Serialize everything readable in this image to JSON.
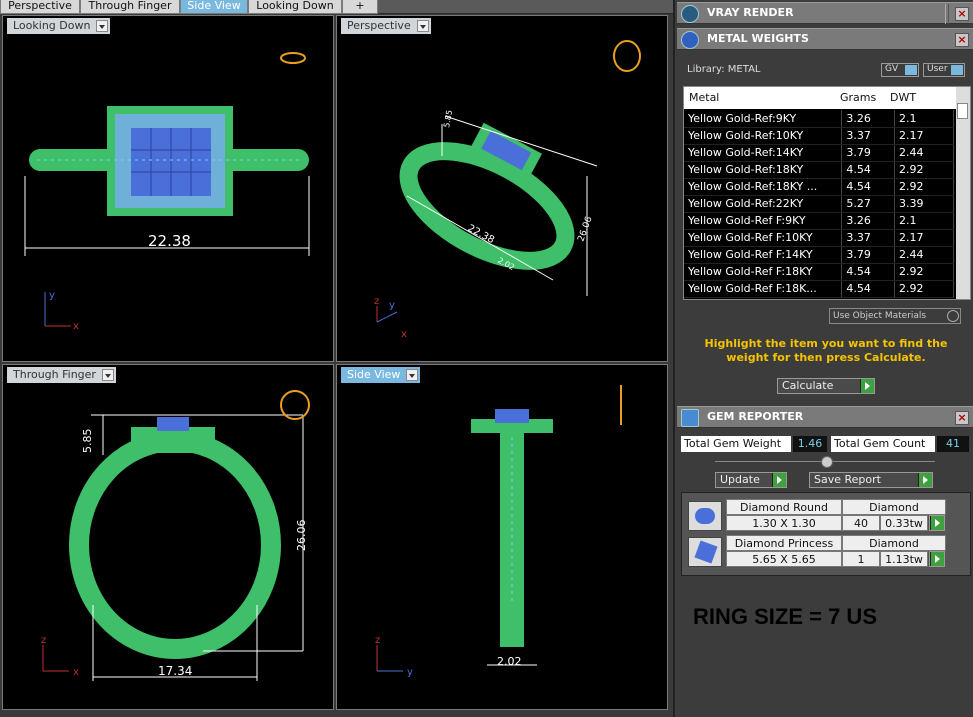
{
  "tabs": [
    "Perspective",
    "Through Finger",
    "Side View",
    "Looking Down",
    "+"
  ],
  "viewports": {
    "top_left": {
      "label": "Looking Down",
      "dimension": "22.38"
    },
    "top_right": {
      "label": "Perspective",
      "dim1": "22.38",
      "dim2": "26.06",
      "dim3": "5.85",
      "dim4": "2.02"
    },
    "bottom_left": {
      "label": "Through Finger",
      "dim_height": "26.06",
      "dim_top": "5.85",
      "dim_width": "17.34"
    },
    "bottom_right": {
      "label": "Side View",
      "dim_width": "2.02"
    }
  },
  "axes": {
    "x": "x",
    "y": "y",
    "z": "z"
  },
  "vray": {
    "title": "VRAY RENDER"
  },
  "metal": {
    "title": "METAL WEIGHTS",
    "library": "Library: METAL",
    "gv": "GV",
    "user": "User",
    "headers": [
      "Metal",
      "Grams",
      "DWT"
    ],
    "rows": [
      [
        "Yellow Gold-Ref:9KY",
        "3.26",
        "2.1"
      ],
      [
        "Yellow Gold-Ref:10KY",
        "3.37",
        "2.17"
      ],
      [
        "Yellow Gold-Ref:14KY",
        "3.79",
        "2.44"
      ],
      [
        "Yellow Gold-Ref:18KY",
        "4.54",
        "2.92"
      ],
      [
        "Yellow Gold-Ref:18KY ...",
        "4.54",
        "2.92"
      ],
      [
        "Yellow Gold-Ref:22KY",
        "5.27",
        "3.39"
      ],
      [
        "Yellow Gold-Ref F:9KY",
        "3.26",
        "2.1"
      ],
      [
        "Yellow Gold-Ref F:10KY",
        "3.37",
        "2.17"
      ],
      [
        "Yellow Gold-Ref F:14KY",
        "3.79",
        "2.44"
      ],
      [
        "Yellow Gold-Ref F:18KY",
        "4.54",
        "2.92"
      ],
      [
        "Yellow Gold-Ref F:18K...",
        "4.54",
        "2.92"
      ]
    ],
    "use_object": "Use Object Materials",
    "hint": "Highlight the item you want to find the weight for then press Calculate.",
    "calculate": "Calculate"
  },
  "gem": {
    "title": "GEM REPORTER",
    "total_weight_label": "Total Gem Weight",
    "total_weight": "1.46",
    "total_count_label": "Total Gem Count",
    "total_count": "41",
    "update": "Update",
    "save_report": "Save Report",
    "items": [
      {
        "name": "Diamond Round",
        "size": "1.30 X 1.30",
        "type": "Diamond",
        "count": "40",
        "weight": "0.33tw"
      },
      {
        "name": "Diamond Princess",
        "size": "5.65 X 5.65",
        "type": "Diamond",
        "count": "1",
        "weight": "1.13tw"
      }
    ]
  },
  "ring_size": "RING SIZE = 7 US",
  "colors": {
    "metal": "#3fbf6a",
    "gem": "#4a6fd8",
    "accent": "#7ab8e0",
    "hint": "#f4c400"
  }
}
